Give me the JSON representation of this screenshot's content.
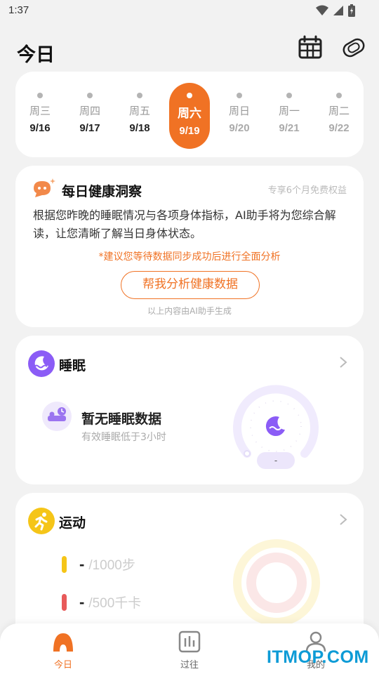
{
  "status_bar": {
    "time": "1:37"
  },
  "header": {
    "title": "今日"
  },
  "date_strip": {
    "days": [
      {
        "weekday": "周三",
        "date": "9/16"
      },
      {
        "weekday": "周四",
        "date": "9/17"
      },
      {
        "weekday": "周五",
        "date": "9/18"
      },
      {
        "weekday": "周六",
        "date": "9/19"
      },
      {
        "weekday": "周日",
        "date": "9/20"
      },
      {
        "weekday": "周一",
        "date": "9/21"
      },
      {
        "weekday": "周二",
        "date": "9/22"
      }
    ],
    "selected": "9/19"
  },
  "ai_insight": {
    "title": "每日健康洞察",
    "promo": "专享6个月免费权益",
    "body": "根据您昨晚的睡眠情况与各项身体指标，AI助手将为您综合解读，让您清晰了解当日身体状态。",
    "note": "*建议您等待数据同步成功后进行全面分析",
    "button": "帮我分析健康数据",
    "footer": "以上内容由AI助手生成"
  },
  "sleep": {
    "title": "睡眠",
    "empty_title": "暂无睡眠数据",
    "empty_sub": "有效睡眠低于3小时",
    "dial_value": "-"
  },
  "sport": {
    "title": "运动",
    "steps_value": "-",
    "steps_goal": "/1000步",
    "calories_value": "-",
    "calories_goal": "/500千卡"
  },
  "nav": {
    "items": [
      {
        "label": "今日"
      },
      {
        "label": "过往"
      },
      {
        "label": "我的"
      }
    ]
  },
  "colors": {
    "accent": "#f07224",
    "sleep": "#8b5cf6",
    "steps": "#f5c518",
    "calories": "#e85a5a"
  },
  "watermark": "ITMOP.COM"
}
